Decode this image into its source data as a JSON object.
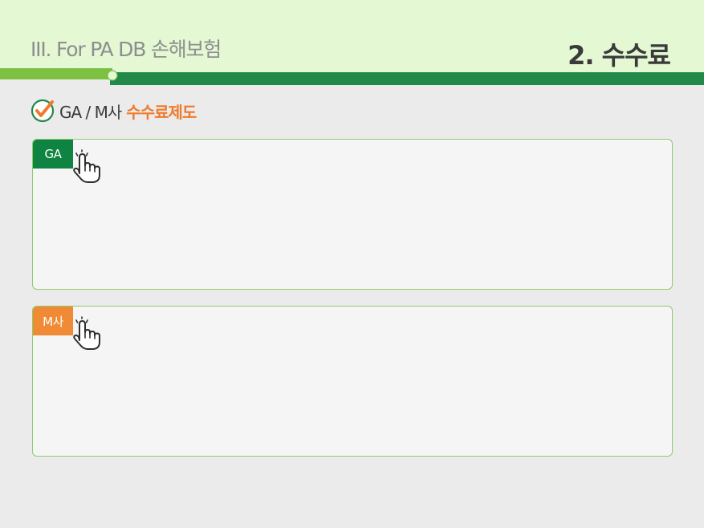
{
  "header": {
    "section_title": "III. For PA DB 손해보험",
    "page_title": "2. 수수료"
  },
  "subheading": {
    "prefix": "GA / M사",
    "highlight": "수수료제도",
    "icon": "check-circle-icon"
  },
  "panels": [
    {
      "tag": "GA",
      "tag_color": "#0f8442",
      "icon": "hand-pointer-icon"
    },
    {
      "tag": "M사",
      "tag_color": "#f08a34",
      "icon": "hand-pointer-icon"
    }
  ],
  "colors": {
    "header_bg": "#e3f8d3",
    "accent_green": "#23894a",
    "light_green": "#7cc142",
    "highlight_orange": "#ef7a2d",
    "page_bg": "#ebebeb"
  }
}
